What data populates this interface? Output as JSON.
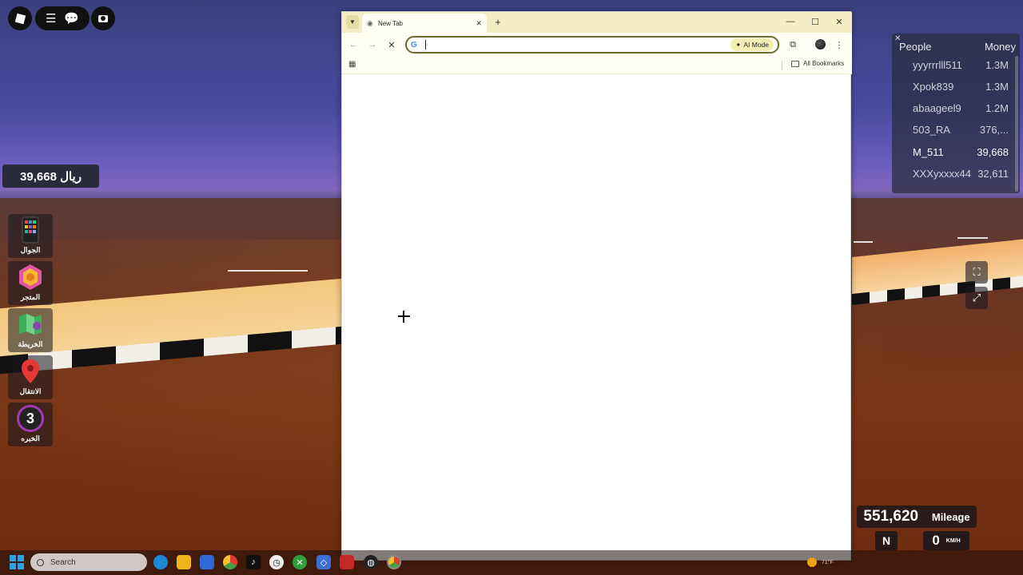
{
  "game": {
    "money_display": "39,668 ريال",
    "side_menu": [
      {
        "label": "الجوال",
        "icon": "phone-icon"
      },
      {
        "label": "المتجر",
        "icon": "store-icon"
      },
      {
        "label": "الخريطة",
        "icon": "map-icon"
      },
      {
        "label": "الانتقال",
        "icon": "location-pin-icon"
      },
      {
        "label": "الخبره",
        "icon": "level-badge-icon",
        "level": "3"
      }
    ],
    "leaderboard": {
      "col_people": "People",
      "col_money": "Money",
      "rows": [
        {
          "name": "yyyrrrlll511",
          "money": "1.3M"
        },
        {
          "name": "Xpok839",
          "money": "1.3M"
        },
        {
          "name": "abaageel9",
          "money": "1.2M"
        },
        {
          "name": "503_RA",
          "money": "376,..."
        },
        {
          "name": "M_511",
          "money": "39,668"
        },
        {
          "name": "XXXyxxxx44",
          "money": "32,611"
        }
      ]
    },
    "mileage_value": "551,620",
    "mileage_label": "Mileage",
    "compass": "N",
    "speed_value": "0",
    "speed_unit": "KM/H"
  },
  "browser": {
    "tab_title": "New Tab",
    "ai_mode_label": "AI Mode",
    "omnibox_value": "",
    "all_bookmarks_label": "All Bookmarks"
  },
  "taskbar": {
    "search_placeholder": "Search",
    "weather_temp": "71°F"
  },
  "colors": {
    "tabstrip": "#f3eec3",
    "omnibox_border": "#6d6a2c",
    "ai_mode_bg": "#f6efb5"
  }
}
